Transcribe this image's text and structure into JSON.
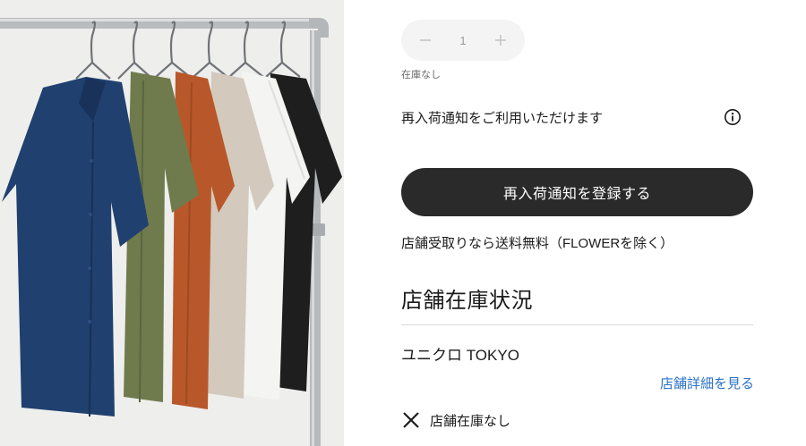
{
  "photo": {
    "alt_icon": "product-photo-shirts-on-rack",
    "shirt_colors": [
      "#1f3f6e",
      "#6e7a4c",
      "#b5592a",
      "#cfc5b9",
      "#f3f3f1",
      "#1d1d1d"
    ]
  },
  "quantity": {
    "value": "1",
    "minus_icon": "minus-icon",
    "plus_icon": "plus-icon"
  },
  "stock_note": "在庫なし",
  "restock": {
    "text": "再入荷通知をご利用いただけます",
    "info_icon": "info-icon"
  },
  "register_button": {
    "label": "再入荷通知を登録する",
    "color": "#2a2a2a"
  },
  "pickup_note": "店舗受取りなら送料無料（FLOWERを除く）",
  "store_stock": {
    "title": "店舗在庫状況",
    "store_name": "ユニクロ TOKYO",
    "details_link": "店舗詳細を見る",
    "link_color": "#2a71c8",
    "status_icon": "close-icon",
    "status_text": "店舗在庫なし"
  }
}
